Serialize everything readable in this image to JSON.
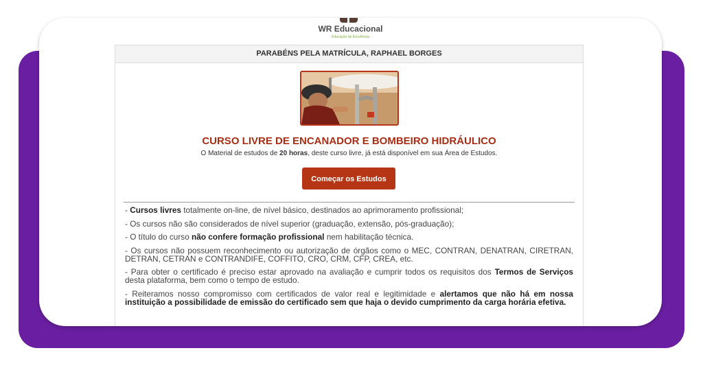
{
  "brand": {
    "name": "WR Educacional",
    "tagline": "Educação de Excelência"
  },
  "panel": {
    "header": "PARABÉNS PELA MATRÍCULA, RAPHAEL BORGES"
  },
  "course": {
    "title": "CURSO LIVRE DE ENCANADOR E BOMBEIRO HIDRÁULICO",
    "subtitle_pre": "O Material de estudos de ",
    "subtitle_hours": "20 horas",
    "subtitle_post": ", deste curso livre, já está disponível em sua Área de Estudos.",
    "button_label": "Começar os Estudos"
  },
  "info": [
    {
      "pre": "- ",
      "bold": "Cursos livres",
      "post": " totalmente on-line, de nível básico, destinados ao aprimoramento profissional;"
    },
    {
      "pre": "- Os cursos não são considerados de nível superior (graduação, extensão, pós-graduação);"
    },
    {
      "pre": "- O título do curso ",
      "bold": "não confere formação profissional",
      "post": " nem habilitação técnica."
    },
    {
      "pre": "- Os cursos não possuem reconhecimento ou autorização de órgãos como o MEC, CONTRAN, DENATRAN, CIRETRAN, DETRAN, CETRAN e CONTRANDIFE, COFFITO, CRO, CRM, CFP, CREA, etc."
    },
    {
      "pre": "- Para obter o certificado é preciso estar aprovado na avaliação e cumprir todos os requisitos dos ",
      "bold": "Termos de Serviços",
      "post": " desta plataforma, bem como o tempo de estudo."
    },
    {
      "pre": "- Reiteramos nosso compromisso com certificados de valor real e legitimidade e ",
      "bold": "alertamos que não há em nossa instituição a possibilidade de emissão do certificado sem que haja o devido cumprimento da carga horária efetiva."
    }
  ],
  "colors": {
    "accent": "#b53515",
    "frame": "#6a1fa2",
    "title": "#a82d12"
  },
  "icons": {
    "logo": "wr-logo-icon"
  }
}
